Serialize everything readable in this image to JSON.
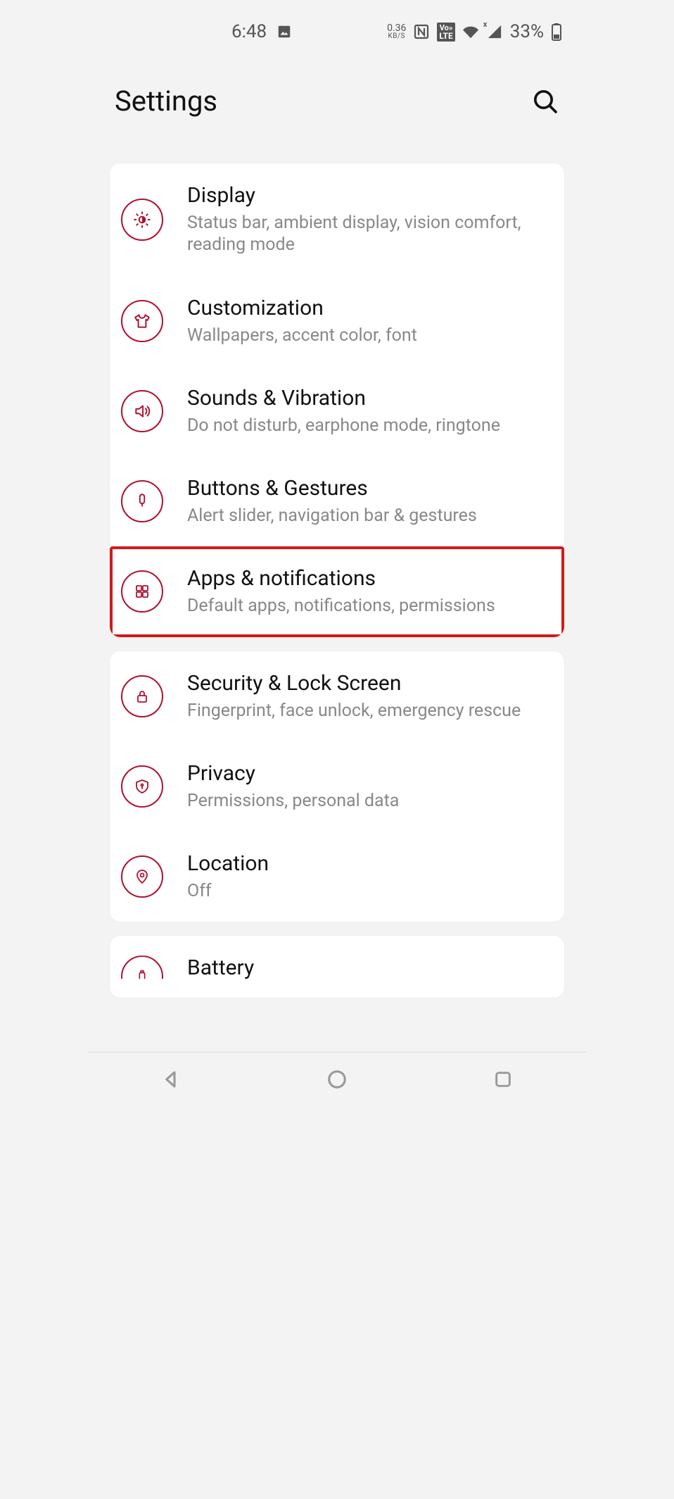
{
  "status_bar": {
    "time": "6:48",
    "data_rate_value": "0.36",
    "data_rate_unit": "KB/S",
    "volte_line1": "Vo»",
    "volte_line2": "LTE",
    "battery_pct": "33%"
  },
  "header": {
    "title": "Settings"
  },
  "groups": [
    {
      "items": [
        {
          "id": "display",
          "title": "Display",
          "subtitle": "Status bar, ambient display, vision comfort, reading mode",
          "icon": "brightness"
        },
        {
          "id": "customization",
          "title": "Customization",
          "subtitle": "Wallpapers, accent color, font",
          "icon": "tshirt"
        },
        {
          "id": "sounds",
          "title": "Sounds & Vibration",
          "subtitle": "Do not disturb, earphone mode, ringtone",
          "icon": "speaker"
        },
        {
          "id": "buttons",
          "title": "Buttons & Gestures",
          "subtitle": "Alert slider, navigation bar & gestures",
          "icon": "touch"
        },
        {
          "id": "apps",
          "title": "Apps & notifications",
          "subtitle": "Default apps, notifications, permissions",
          "icon": "grid",
          "highlighted": true
        }
      ]
    },
    {
      "items": [
        {
          "id": "security",
          "title": "Security & Lock Screen",
          "subtitle": "Fingerprint, face unlock, emergency rescue",
          "icon": "lock"
        },
        {
          "id": "privacy",
          "title": "Privacy",
          "subtitle": "Permissions, personal data",
          "icon": "shield"
        },
        {
          "id": "location",
          "title": "Location",
          "subtitle": "Off",
          "icon": "pin"
        }
      ]
    },
    {
      "items": [
        {
          "id": "battery",
          "title": "Battery",
          "subtitle": "",
          "icon": "battery",
          "partial": true
        }
      ]
    }
  ],
  "colors": {
    "accent": "#b01030",
    "highlight_box": "#d11a1a"
  }
}
